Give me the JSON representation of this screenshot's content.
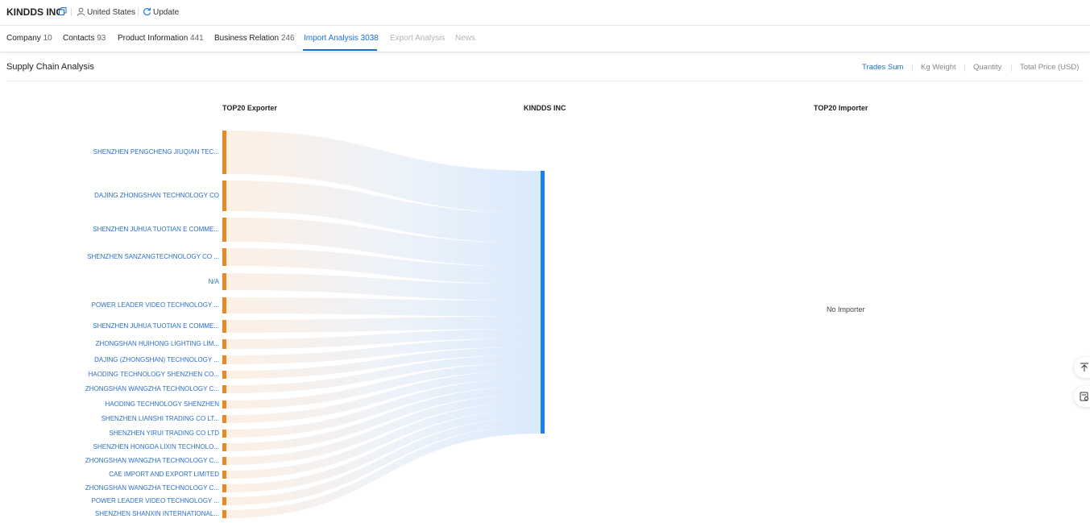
{
  "header": {
    "company": "KINDDS INC",
    "country": "United States",
    "update_label": "Update",
    "icons": [
      "copy-icon",
      "user-icon",
      "refresh-icon"
    ]
  },
  "tabs": [
    {
      "label": "Company",
      "count": "10",
      "state": "normal"
    },
    {
      "label": "Contacts",
      "count": "93",
      "state": "normal"
    },
    {
      "label": "Product Information",
      "count": "441",
      "state": "normal"
    },
    {
      "label": "Business Relation",
      "count": "246",
      "state": "normal"
    },
    {
      "label": "Import Analysis",
      "count": "3038",
      "state": "active"
    },
    {
      "label": "Export Analysis",
      "count": "",
      "state": "disabled"
    },
    {
      "label": "News",
      "count": "",
      "state": "disabled"
    }
  ],
  "section": {
    "title": "Supply Chain Analysis",
    "metrics": [
      {
        "label": "Trades Sum",
        "active": true
      },
      {
        "label": "Kg Weight",
        "active": false
      },
      {
        "label": "Quantity",
        "active": false
      },
      {
        "label": "Total Price (USD)",
        "active": false
      }
    ]
  },
  "sankey": {
    "left_heading": "TOP20 Exporter",
    "center_heading": "KINDDS INC",
    "right_heading": "TOP20 Importer",
    "no_importer": "No Importer",
    "colors": {
      "exporter_node": "#e38a2b",
      "company_node": "#1a7fef",
      "label": "#2b6fc8"
    },
    "exporters": [
      "SHENZHEN PENGCHENG JIUQIAN TEC...",
      "DAJING ZHONGSHAN TECHNOLOGY CO",
      "SHENZHEN JUHUA TUOTIAN E COMME...",
      "SHENZHEN SANZANGTECHNOLOGY CO ...",
      "N/A",
      "POWER LEADER VIDEO TECHNOLOGY ...",
      "SHENZHEN JUHUA TUOTIAN E COMME...",
      "ZHONGSHAN HUIHONG LIGHTING LIM...",
      "DAJING (ZHONGSHAN) TECHNOLOGY ...",
      "HAODING TECHNOLOGY SHENZHEN CO...",
      "ZHONGSHAN WANGZHA TECHNOLOGY C...",
      "HAODING TECHNOLOGY SHENZHEN",
      "SHENZHEN LIANSHI TRADING CO LT...",
      "SHENZHEN YIRUI TRADING CO LTD",
      "SHENZHEN HONGDA LIXIN TECHNOLO...",
      "ZHONGSHAN WANGZHA TECHNOLOGY C...",
      "CAE IMPORT AND EXPORT LIMITED",
      "ZHONGSHAN WANGZHA TECHNOLOGY C...",
      "POWER LEADER VIDEO TECHNOLOGY ...",
      "SHENZHEN SHANXIN INTERNATIONAL..."
    ]
  },
  "side_buttons": [
    "back-to-top-icon",
    "report-icon"
  ]
}
